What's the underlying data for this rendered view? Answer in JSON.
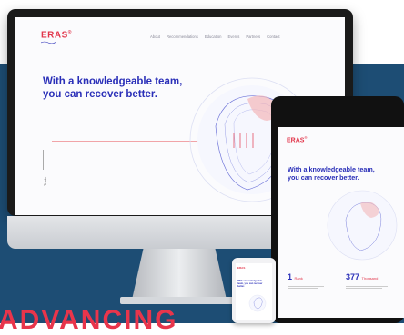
{
  "desktop": {
    "logo": "ERAS",
    "logo_mark": "®",
    "nav": [
      "About",
      "Recommendations",
      "Education",
      "Events",
      "Partners",
      "Contact"
    ],
    "hero_line1": "With a knowledgeable team,",
    "hero_line2": "you can recover better.",
    "side_label": "Trade"
  },
  "tablet": {
    "logo": "ERAS",
    "logo_mark": "®",
    "hero_line1": "With a knowledgeable team,",
    "hero_line2": "you can recover better.",
    "stats": [
      {
        "value": "1",
        "unit": "Rank"
      },
      {
        "value": "377",
        "unit": "Thousand"
      }
    ]
  },
  "phone": {
    "logo": "ERAS",
    "hero": "With a knowledgeable team, you can recover better."
  },
  "banner": {
    "text": "ADVANCING"
  },
  "colors": {
    "brand_red": "#e2364b",
    "brand_blue": "#2a2fb8",
    "background_blue": "#1d4d74"
  }
}
